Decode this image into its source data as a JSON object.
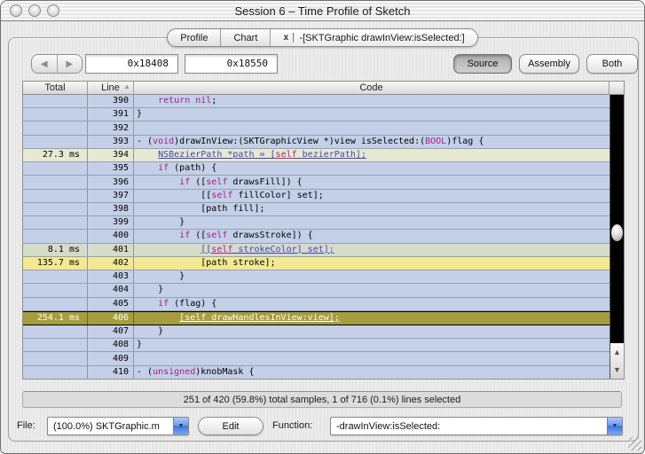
{
  "window": {
    "title": "Session 6 – Time Profile of Sketch"
  },
  "tabs": {
    "close_icon": "x",
    "items": [
      {
        "label": "Profile"
      },
      {
        "label": "Chart"
      },
      {
        "label": "-[SKTGraphic drawInView:isSelected:]"
      }
    ]
  },
  "toolbar": {
    "back_icon": "◀",
    "forward_icon": "▶",
    "address_from": "0x18408",
    "address_to": "0x18550",
    "source_label": "Source",
    "assembly_label": "Assembly",
    "both_label": "Both"
  },
  "table": {
    "headers": {
      "total": "Total",
      "line": "Line",
      "code": "Code"
    },
    "sort_icon": "▲",
    "rows": [
      {
        "total": "",
        "line": "390",
        "highlight": "",
        "code": [
          [
            "    "
          ],
          [
            "return",
            "kw"
          ],
          [
            " "
          ],
          [
            "nil",
            "kw"
          ],
          [
            ";"
          ]
        ]
      },
      {
        "total": "",
        "line": "391",
        "highlight": "",
        "code": [
          [
            "}"
          ]
        ]
      },
      {
        "total": "",
        "line": "392",
        "highlight": "",
        "code": []
      },
      {
        "total": "",
        "line": "393",
        "highlight": "",
        "code": [
          [
            "- ("
          ],
          [
            "void",
            "kw"
          ],
          [
            ")drawInView:(SKTGraphicView *)view isSelected:("
          ],
          [
            "BOOL",
            "kw"
          ],
          [
            ")flag {"
          ]
        ]
      },
      {
        "total": "27.3 ms",
        "line": "394",
        "highlight": "green1",
        "code": [
          [
            "    "
          ],
          [
            "NSBezierPath *path = [",
            "link"
          ],
          [
            "self",
            "linkkw"
          ],
          [
            " bezierPath];",
            "link"
          ]
        ]
      },
      {
        "total": "",
        "line": "395",
        "highlight": "",
        "code": [
          [
            "    "
          ],
          [
            "if",
            "kw"
          ],
          [
            " (path) {"
          ]
        ]
      },
      {
        "total": "",
        "line": "396",
        "highlight": "",
        "code": [
          [
            "        "
          ],
          [
            "if",
            "kw"
          ],
          [
            " (["
          ],
          [
            "self",
            "kw"
          ],
          [
            " drawsFill]) {"
          ]
        ]
      },
      {
        "total": "",
        "line": "397",
        "highlight": "",
        "code": [
          [
            "            [["
          ],
          [
            "self",
            "kw"
          ],
          [
            " fillColor] set];"
          ]
        ]
      },
      {
        "total": "",
        "line": "398",
        "highlight": "",
        "code": [
          [
            "            [path fill];"
          ]
        ]
      },
      {
        "total": "",
        "line": "399",
        "highlight": "",
        "code": [
          [
            "        }"
          ]
        ]
      },
      {
        "total": "",
        "line": "400",
        "highlight": "",
        "code": [
          [
            "        "
          ],
          [
            "if",
            "kw"
          ],
          [
            " (["
          ],
          [
            "self",
            "kw"
          ],
          [
            " drawsStroke]) {"
          ]
        ]
      },
      {
        "total": "8.1 ms",
        "line": "401",
        "highlight": "green2",
        "code": [
          [
            "            "
          ],
          [
            "[[",
            "link"
          ],
          [
            "self",
            "linkkw"
          ],
          [
            " strokeColor] set];",
            "link"
          ]
        ]
      },
      {
        "total": "135.7 ms",
        "line": "402",
        "highlight": "yellow",
        "code": [
          [
            "            [path stroke];"
          ]
        ]
      },
      {
        "total": "",
        "line": "403",
        "highlight": "",
        "code": [
          [
            "        }"
          ]
        ]
      },
      {
        "total": "",
        "line": "404",
        "highlight": "",
        "code": [
          [
            "    }"
          ]
        ]
      },
      {
        "total": "",
        "line": "405",
        "highlight": "",
        "code": [
          [
            "    "
          ],
          [
            "if",
            "kw"
          ],
          [
            " (flag) {"
          ]
        ]
      },
      {
        "total": "254.1 ms",
        "line": "406",
        "highlight": "selected",
        "code": [
          [
            "        "
          ],
          [
            "[self drawHandlesInView:view];",
            "sellink"
          ]
        ]
      },
      {
        "total": "",
        "line": "407",
        "highlight": "",
        "code": [
          [
            "    }"
          ]
        ]
      },
      {
        "total": "",
        "line": "408",
        "highlight": "",
        "code": [
          [
            "}"
          ]
        ]
      },
      {
        "total": "",
        "line": "409",
        "highlight": "",
        "code": []
      },
      {
        "total": "",
        "line": "410",
        "highlight": "",
        "code": [
          [
            "- ("
          ],
          [
            "unsigned",
            "kw"
          ],
          [
            ")knobMask {"
          ]
        ]
      }
    ]
  },
  "scrollbar": {
    "up_icon": "▲",
    "down_icon": "▼"
  },
  "status_bar": {
    "text": "251 of 420 (59.8%) total samples, 1 of 716 (0.1%) lines selected"
  },
  "footer": {
    "file_label": "File:",
    "file_value": "(100.0%) SKTGraphic.m",
    "edit_button": "Edit",
    "function_label": "Function:",
    "function_value": "-drawInView:isSelected:",
    "dropdown_icon": "▼"
  },
  "colors": {
    "row_blue": "#c3d0e8",
    "row_sampled_green": "#e7e9d2",
    "row_sampled_gray_green": "#d5dcca",
    "row_hot_yellow": "#f2e992",
    "row_selected_olive": "#a69d3e",
    "keyword_magenta": "#a81c8e",
    "link_blue": "#3f3fc0",
    "combo_button_blue": "#6d9ff0"
  }
}
